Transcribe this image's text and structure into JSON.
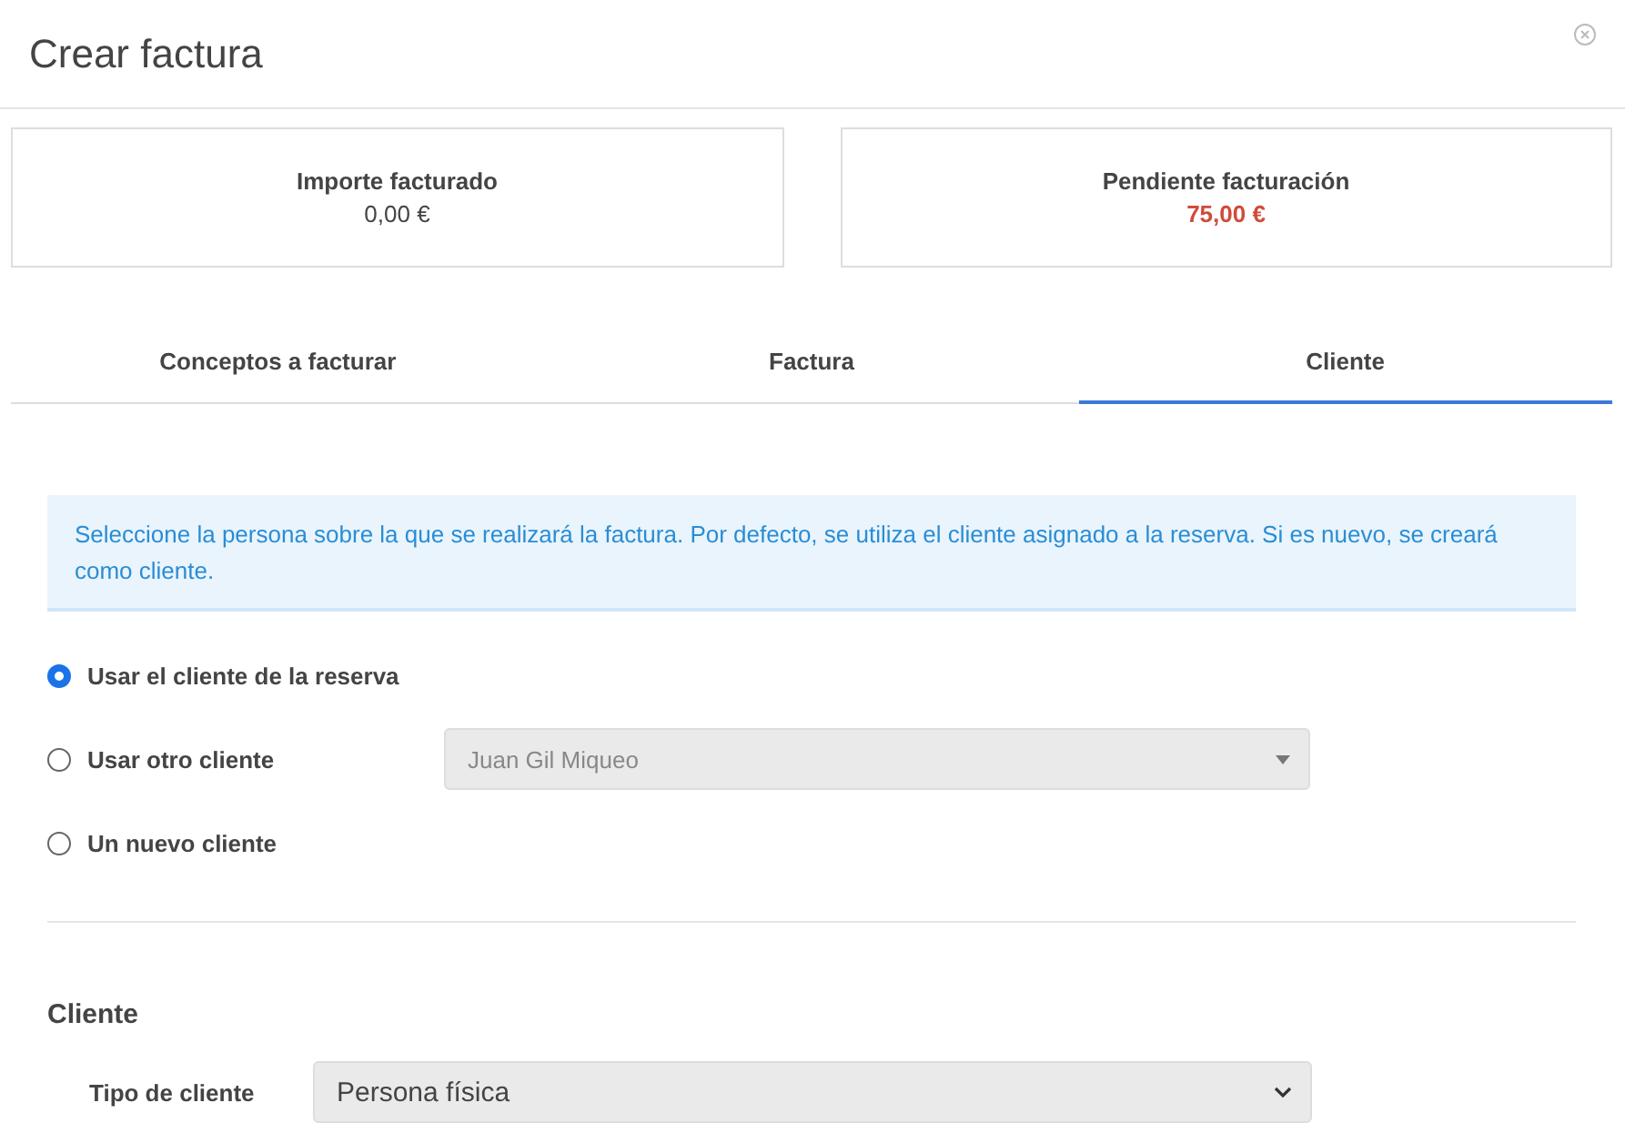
{
  "window": {
    "title": "Crear factura"
  },
  "summary": [
    {
      "label": "Importe facturado",
      "value": "0,00 €",
      "kind": "normal"
    },
    {
      "label": "Pendiente facturación",
      "value": "75,00 €",
      "kind": "alert"
    }
  ],
  "tabs": [
    {
      "label": "Conceptos a facturar",
      "selected": false
    },
    {
      "label": "Factura",
      "selected": false
    },
    {
      "label": "Cliente",
      "selected": true
    }
  ],
  "info": "Seleccione la persona sobre la que se realizará la factura. Por defecto, se utiliza el cliente asignado a la reserva. Si es nuevo, se creará como cliente.",
  "options": [
    {
      "label": "Usar el cliente de la reserva",
      "selected": true
    },
    {
      "label": "Usar otro cliente",
      "selected": false,
      "select": {
        "value": "Juan Gil Miqueo",
        "disabled": true
      }
    },
    {
      "label": "Un nuevo cliente",
      "selected": false
    }
  ],
  "client_section": {
    "title": "Cliente",
    "fields": [
      {
        "label": "Tipo de cliente",
        "value": "Persona física"
      }
    ]
  }
}
